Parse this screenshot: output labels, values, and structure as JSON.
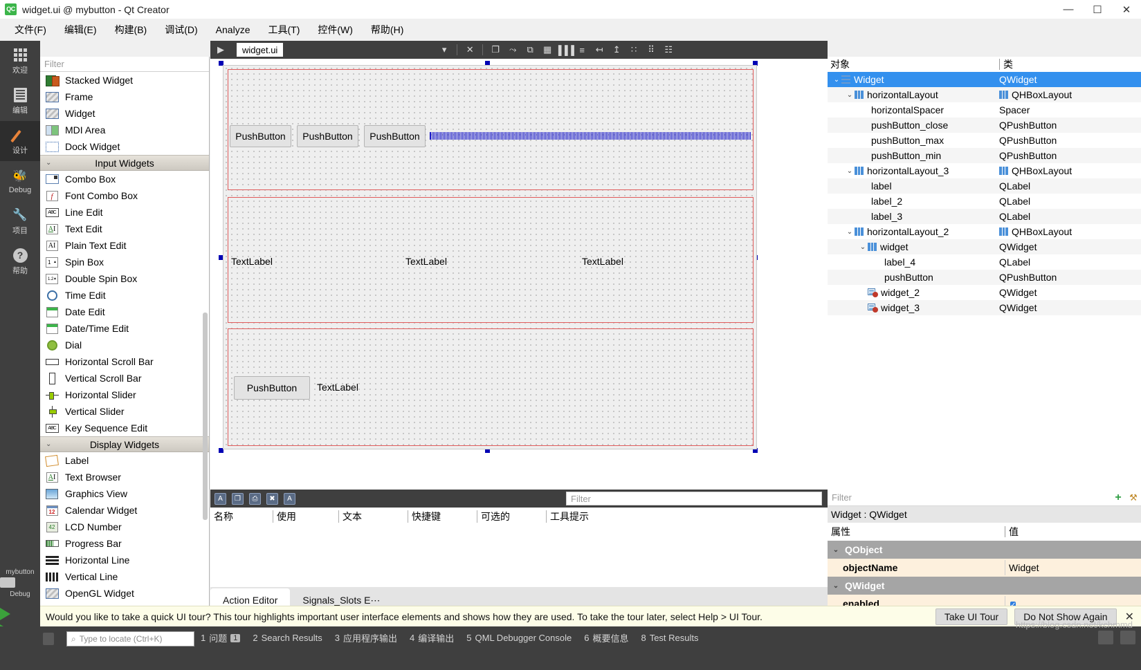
{
  "window": {
    "title": "widget.ui @ mybutton - Qt Creator",
    "logo_text": "QC",
    "minimize": "—",
    "maximize": "☐",
    "close": "✕"
  },
  "menubar": [
    {
      "label": "文件(F)"
    },
    {
      "label": "编辑(E)"
    },
    {
      "label": "构建(B)"
    },
    {
      "label": "调试(D)"
    },
    {
      "label": "Analyze"
    },
    {
      "label": "工具(T)"
    },
    {
      "label": "控件(W)"
    },
    {
      "label": "帮助(H)"
    }
  ],
  "modebar": {
    "items": [
      {
        "label": "欢迎",
        "icon": "grid-icon"
      },
      {
        "label": "编辑",
        "icon": "document-icon"
      },
      {
        "label": "设计",
        "icon": "pencil-icon"
      },
      {
        "label": "Debug",
        "icon": "bug-icon"
      },
      {
        "label": "项目",
        "icon": "wrench-icon"
      },
      {
        "label": "帮助",
        "icon": "question-icon"
      }
    ],
    "kit_name": "mybutton",
    "kit_mode": "Debug"
  },
  "widget_box": {
    "filter_placeholder": "Filter",
    "items": [
      {
        "label": "Stacked Widget",
        "icon": "stacked-widget-icon",
        "type": "item"
      },
      {
        "label": "Frame",
        "icon": "frame-icon",
        "type": "item"
      },
      {
        "label": "Widget",
        "icon": "widget-icon",
        "type": "item"
      },
      {
        "label": "MDI Area",
        "icon": "mdi-area-icon",
        "type": "item"
      },
      {
        "label": "Dock Widget",
        "icon": "dock-widget-icon",
        "type": "item"
      },
      {
        "label": "Input Widgets",
        "type": "category"
      },
      {
        "label": "Combo Box",
        "icon": "combo-box-icon",
        "type": "item"
      },
      {
        "label": "Font Combo Box",
        "icon": "font-combo-box-icon",
        "type": "item"
      },
      {
        "label": "Line Edit",
        "icon": "line-edit-icon",
        "type": "item"
      },
      {
        "label": "Text Edit",
        "icon": "text-edit-icon",
        "type": "item"
      },
      {
        "label": "Plain Text Edit",
        "icon": "plain-text-edit-icon",
        "type": "item"
      },
      {
        "label": "Spin Box",
        "icon": "spin-box-icon",
        "type": "item"
      },
      {
        "label": "Double Spin Box",
        "icon": "double-spin-box-icon",
        "type": "item"
      },
      {
        "label": "Time Edit",
        "icon": "time-edit-icon",
        "type": "item"
      },
      {
        "label": "Date Edit",
        "icon": "date-edit-icon",
        "type": "item"
      },
      {
        "label": "Date/Time Edit",
        "icon": "date-time-edit-icon",
        "type": "item"
      },
      {
        "label": "Dial",
        "icon": "dial-icon",
        "type": "item"
      },
      {
        "label": "Horizontal Scroll Bar",
        "icon": "horizontal-scroll-bar-icon",
        "type": "item"
      },
      {
        "label": "Vertical Scroll Bar",
        "icon": "vertical-scroll-bar-icon",
        "type": "item"
      },
      {
        "label": "Horizontal Slider",
        "icon": "horizontal-slider-icon",
        "type": "item"
      },
      {
        "label": "Vertical Slider",
        "icon": "vertical-slider-icon",
        "type": "item"
      },
      {
        "label": "Key Sequence Edit",
        "icon": "key-sequence-edit-icon",
        "type": "item"
      },
      {
        "label": "Display Widgets",
        "type": "category"
      },
      {
        "label": "Label",
        "icon": "label-icon",
        "type": "item"
      },
      {
        "label": "Text Browser",
        "icon": "text-browser-icon",
        "type": "item"
      },
      {
        "label": "Graphics View",
        "icon": "graphics-view-icon",
        "type": "item"
      },
      {
        "label": "Calendar Widget",
        "icon": "calendar-widget-icon",
        "type": "item"
      },
      {
        "label": "LCD Number",
        "icon": "lcd-number-icon",
        "type": "item"
      },
      {
        "label": "Progress Bar",
        "icon": "progress-bar-icon",
        "type": "item"
      },
      {
        "label": "Horizontal Line",
        "icon": "horizontal-line-icon",
        "type": "item"
      },
      {
        "label": "Vertical Line",
        "icon": "vertical-line-icon",
        "type": "item"
      },
      {
        "label": "OpenGL Widget",
        "icon": "opengl-widget-icon",
        "type": "item"
      }
    ]
  },
  "editor": {
    "tab_label": "widget.ui",
    "close_tab": "✕",
    "dropdown": "▾",
    "toolbar": [
      {
        "name": "edit-widgets-icon",
        "glyph": "❐"
      },
      {
        "name": "edit-signals-slots-icon",
        "glyph": "⤳"
      },
      {
        "name": "edit-buddies-icon",
        "glyph": "⧉"
      },
      {
        "name": "edit-tab-order-icon",
        "glyph": "▦"
      },
      {
        "name": "layout-horizontally-icon",
        "glyph": "▐▐▐"
      },
      {
        "name": "layout-vertically-icon",
        "glyph": "≡"
      },
      {
        "name": "layout-horizontally-splitter-icon",
        "glyph": "↤"
      },
      {
        "name": "layout-vertically-splitter-icon",
        "glyph": "↥"
      },
      {
        "name": "layout-form-icon",
        "glyph": "∷"
      },
      {
        "name": "layout-grid-icon",
        "glyph": "⠿"
      },
      {
        "name": "break-layout-icon",
        "glyph": "☷"
      }
    ],
    "form": {
      "row1": {
        "buttons": [
          "PushButton",
          "PushButton",
          "PushButton"
        ],
        "spacer": "horizontalSpacer"
      },
      "row2": {
        "labels": [
          "TextLabel",
          "TextLabel",
          "TextLabel"
        ]
      },
      "row3": {
        "button": "PushButton",
        "label": "TextLabel"
      }
    }
  },
  "action_editor": {
    "filter_placeholder": "Filter",
    "columns": [
      "名称",
      "使用",
      "文本",
      "快捷键",
      "可选的",
      "工具提示"
    ],
    "toolbar": [
      {
        "name": "new-action-icon",
        "glyph": "A"
      },
      {
        "name": "copy-action-icon",
        "glyph": "❐"
      },
      {
        "name": "paste-action-icon",
        "glyph": "⎙"
      },
      {
        "name": "delete-action-icon",
        "glyph": "✖"
      },
      {
        "name": "view-mode-icon",
        "glyph": "A"
      }
    ],
    "tabs": [
      {
        "label": "Action Editor",
        "active": true
      },
      {
        "label": "Signals_Slots E⋯",
        "active": false
      }
    ]
  },
  "object_inspector": {
    "columns": [
      "对象",
      "类"
    ],
    "rows": [
      {
        "name": "Widget",
        "cls": "QWidget",
        "indent": 0,
        "chev": "⌄",
        "icon": "form-icon",
        "cls_icon": "",
        "selected": true
      },
      {
        "name": "horizontalLayout",
        "cls": "QHBoxLayout",
        "indent": 1,
        "chev": "⌄",
        "icon": "layout-icon",
        "cls_icon": "layout-icon"
      },
      {
        "name": "horizontalSpacer",
        "cls": "Spacer",
        "indent": 2,
        "chev": "",
        "icon": "",
        "cls_icon": ""
      },
      {
        "name": "pushButton_close",
        "cls": "QPushButton",
        "indent": 2,
        "chev": "",
        "icon": "",
        "cls_icon": ""
      },
      {
        "name": "pushButton_max",
        "cls": "QPushButton",
        "indent": 2,
        "chev": "",
        "icon": "",
        "cls_icon": ""
      },
      {
        "name": "pushButton_min",
        "cls": "QPushButton",
        "indent": 2,
        "chev": "",
        "icon": "",
        "cls_icon": ""
      },
      {
        "name": "horizontalLayout_3",
        "cls": "QHBoxLayout",
        "indent": 1,
        "chev": "⌄",
        "icon": "layout-icon",
        "cls_icon": "layout-icon"
      },
      {
        "name": "label",
        "cls": "QLabel",
        "indent": 2,
        "chev": "",
        "icon": "",
        "cls_icon": ""
      },
      {
        "name": "label_2",
        "cls": "QLabel",
        "indent": 2,
        "chev": "",
        "icon": "",
        "cls_icon": ""
      },
      {
        "name": "label_3",
        "cls": "QLabel",
        "indent": 2,
        "chev": "",
        "icon": "",
        "cls_icon": ""
      },
      {
        "name": "horizontalLayout_2",
        "cls": "QHBoxLayout",
        "indent": 1,
        "chev": "⌄",
        "icon": "layout-icon",
        "cls_icon": "layout-icon"
      },
      {
        "name": "widget",
        "cls": "QWidget",
        "indent": 2,
        "chev": "⌄",
        "icon": "layout-icon",
        "cls_icon": ""
      },
      {
        "name": "label_4",
        "cls": "QLabel",
        "indent": 3,
        "chev": "",
        "icon": "",
        "cls_icon": ""
      },
      {
        "name": "pushButton",
        "cls": "QPushButton",
        "indent": 3,
        "chev": "",
        "icon": "",
        "cls_icon": ""
      },
      {
        "name": "widget_2",
        "cls": "QWidget",
        "indent": 2,
        "chev": "",
        "icon": "nolayout-icon",
        "cls_icon": ""
      },
      {
        "name": "widget_3",
        "cls": "QWidget",
        "indent": 2,
        "chev": "",
        "icon": "nolayout-icon",
        "cls_icon": ""
      }
    ]
  },
  "property_editor": {
    "filter_placeholder": "Filter",
    "add_button": "+",
    "config_button": "⚒",
    "object_header": "Widget : QWidget",
    "columns": [
      "属性",
      "值"
    ],
    "groups": [
      {
        "title": "QObject",
        "rows": [
          {
            "key": "objectName",
            "value": "Widget",
            "type": "text"
          }
        ]
      },
      {
        "title": "QWidget",
        "rows": [
          {
            "key": "enabled",
            "value": "",
            "type": "checkbox"
          }
        ]
      }
    ]
  },
  "tour_banner": {
    "message": "Would you like to take a quick UI tour? This tour highlights important user interface elements and shows how they are used. To take the tour later, select Help > UI Tour.",
    "primary_button": "Take UI Tour",
    "secondary_button": "Do Not Show Again",
    "close": "✕"
  },
  "status_bar": {
    "locate_placeholder": "Type to locate (Ctrl+K)",
    "search_icon": "⌕",
    "output_tabs": [
      {
        "num": "1",
        "label": "问题",
        "badge": "1"
      },
      {
        "num": "2",
        "label": "Search Results",
        "badge": ""
      },
      {
        "num": "3",
        "label": "应用程序输出",
        "badge": ""
      },
      {
        "num": "4",
        "label": "编译输出",
        "badge": ""
      },
      {
        "num": "5",
        "label": "QML Debugger Console",
        "badge": ""
      },
      {
        "num": "6",
        "label": "概要信息",
        "badge": ""
      },
      {
        "num": "8",
        "label": "Test Results",
        "badge": ""
      }
    ]
  },
  "watermark": "https://blog.csdn.net/kchmmd",
  "colors": {
    "selection": "#3390ee",
    "dark_chrome": "#3f3f3f",
    "form_guide": "#e05b5b",
    "banner": "#fdfde8",
    "accent_green": "#3cb54a"
  }
}
